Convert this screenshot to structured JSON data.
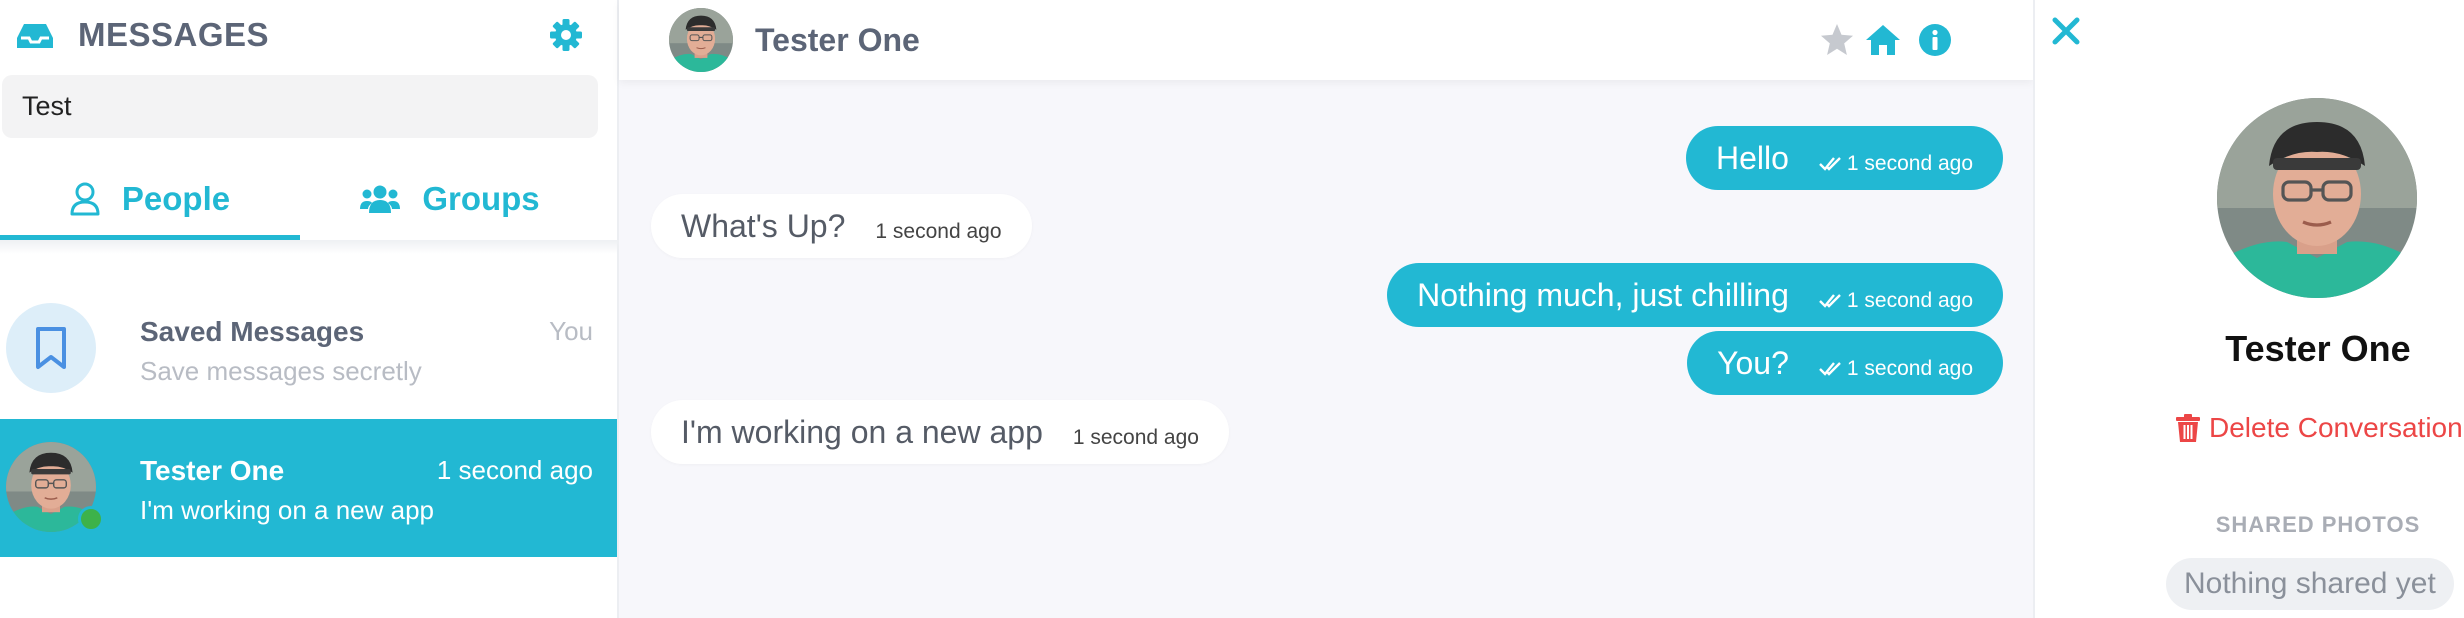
{
  "colors": {
    "accent": "#22b8d3",
    "danger": "#ec4646",
    "online": "#3db24a"
  },
  "sidebar": {
    "title": "MESSAGES",
    "search": {
      "value": "Test"
    },
    "tabs": [
      {
        "label": "People",
        "icon": "user-icon",
        "active": true
      },
      {
        "label": "Groups",
        "icon": "users-icon",
        "active": false
      }
    ],
    "conversations": [
      {
        "name": "Saved Messages",
        "preview": "Save messages secretly",
        "time": "You",
        "icon": "bookmark-icon"
      },
      {
        "name": "Tester One",
        "preview": "I'm working on a new app",
        "time": "1 second ago",
        "active": true,
        "online": true
      }
    ]
  },
  "chat": {
    "contact_name": "Tester One",
    "header_icons": [
      "star-icon",
      "home-icon",
      "info-icon"
    ],
    "messages": [
      {
        "direction": "out",
        "text": "Hello",
        "time": "1 second ago"
      },
      {
        "direction": "in",
        "text": "What's Up?",
        "time": "1 second ago"
      },
      {
        "direction": "out",
        "text": "Nothing much, just chilling",
        "time": "1 second ago"
      },
      {
        "direction": "out",
        "text": "You?",
        "time": "1 second ago"
      },
      {
        "direction": "in",
        "text": "I'm working on a new app",
        "time": "1 second ago"
      }
    ]
  },
  "details": {
    "name": "Tester One",
    "delete_label": "Delete Conversation",
    "shared_title": "SHARED PHOTOS",
    "shared_empty": "Nothing shared yet"
  }
}
